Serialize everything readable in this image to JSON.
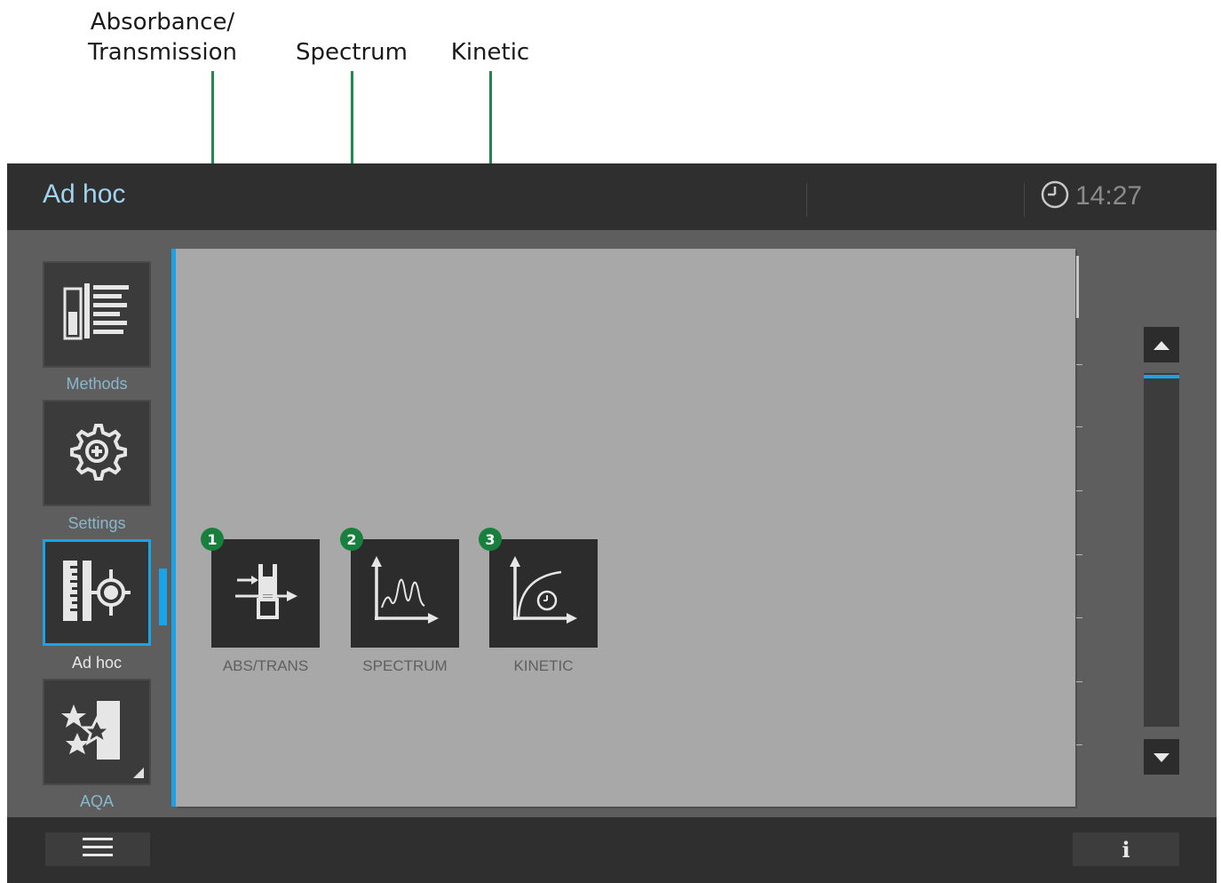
{
  "callouts": [
    {
      "number": "1",
      "label_line1": "Absorbance/",
      "label_line2": "Transmission"
    },
    {
      "number": "2",
      "label": "Spectrum"
    },
    {
      "number": "3",
      "label": "Kinetic"
    }
  ],
  "header": {
    "title": "Ad hoc",
    "time": "14:27"
  },
  "sidebar": {
    "items": [
      {
        "label": "Methods",
        "icon": "methods-icon"
      },
      {
        "label": "Settings",
        "icon": "settings-gear-icon"
      },
      {
        "label": "Ad hoc",
        "icon": "ad-hoc-icon",
        "active": true
      },
      {
        "label": "AQA",
        "icon": "aqa-icon"
      }
    ]
  },
  "tiles": [
    {
      "label": "ABS/TRANS",
      "icon": "abs-trans-icon"
    },
    {
      "label": "SPECTRUM",
      "icon": "spectrum-icon"
    },
    {
      "label": "KINETIC",
      "icon": "kinetic-icon"
    }
  ],
  "footer": {
    "info_label": "i"
  },
  "colors": {
    "accent": "#1aa3e6",
    "header_title": "#9fd3ee",
    "callout": "#16803c"
  }
}
